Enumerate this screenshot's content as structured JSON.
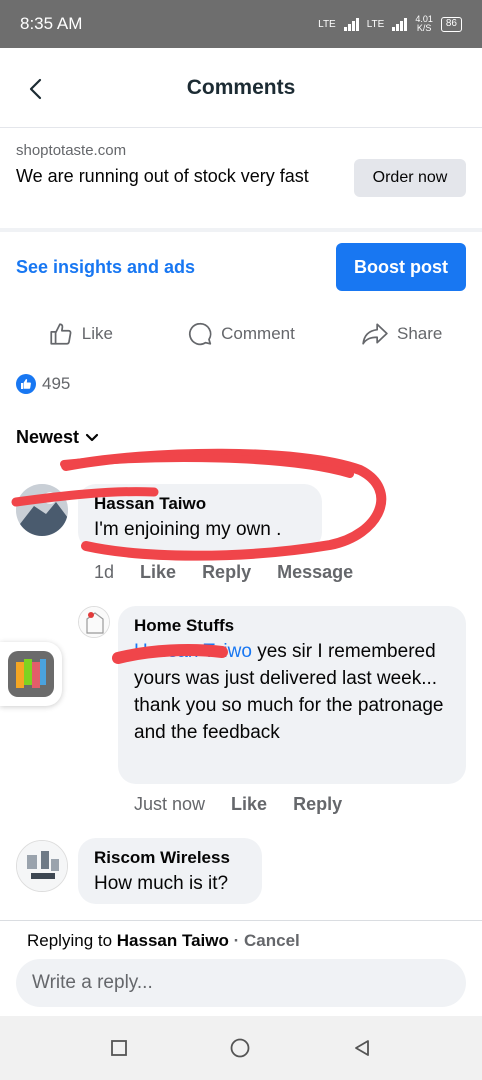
{
  "status_bar": {
    "time": "8:35 AM",
    "net1": "LTE",
    "net2": "LTE",
    "speed": "4.01",
    "speed_unit": "K/S",
    "battery": "86"
  },
  "header": {
    "title": "Comments",
    "back_icon": "chevron-left-icon"
  },
  "ad": {
    "domain": "shoptotaste.com",
    "text": "We are running out of stock very fast",
    "cta": "Order now"
  },
  "insights": {
    "link": "See insights and ads",
    "boost": "Boost post"
  },
  "actions": {
    "like": "Like",
    "comment": "Comment",
    "share": "Share"
  },
  "reactions": {
    "count": "495"
  },
  "sort": {
    "label": "Newest"
  },
  "comments": [
    {
      "name": "Hassan Taiwo",
      "text": "I'm enjoining my own .",
      "time": "1d",
      "like": "Like",
      "reply": "Reply",
      "message": "Message"
    },
    {
      "name": "Home Stuffs",
      "mention": "Hassan Taiwo",
      "text": " yes sir I remembered yours was just delivered last week... thank you so much for the patronage and the feedback",
      "time": "Just now",
      "like": "Like",
      "reply": "Reply"
    },
    {
      "name": "Riscom Wireless",
      "text": "How much is it?"
    }
  ],
  "reply_bar": {
    "prefix": "Replying to ",
    "target": "Hassan Taiwo",
    "cancel": " · Cancel",
    "placeholder": "Write a reply..."
  },
  "colors": {
    "accent": "#1877f2",
    "scribble": "#f0454a",
    "bubble": "#f0f2f5"
  }
}
